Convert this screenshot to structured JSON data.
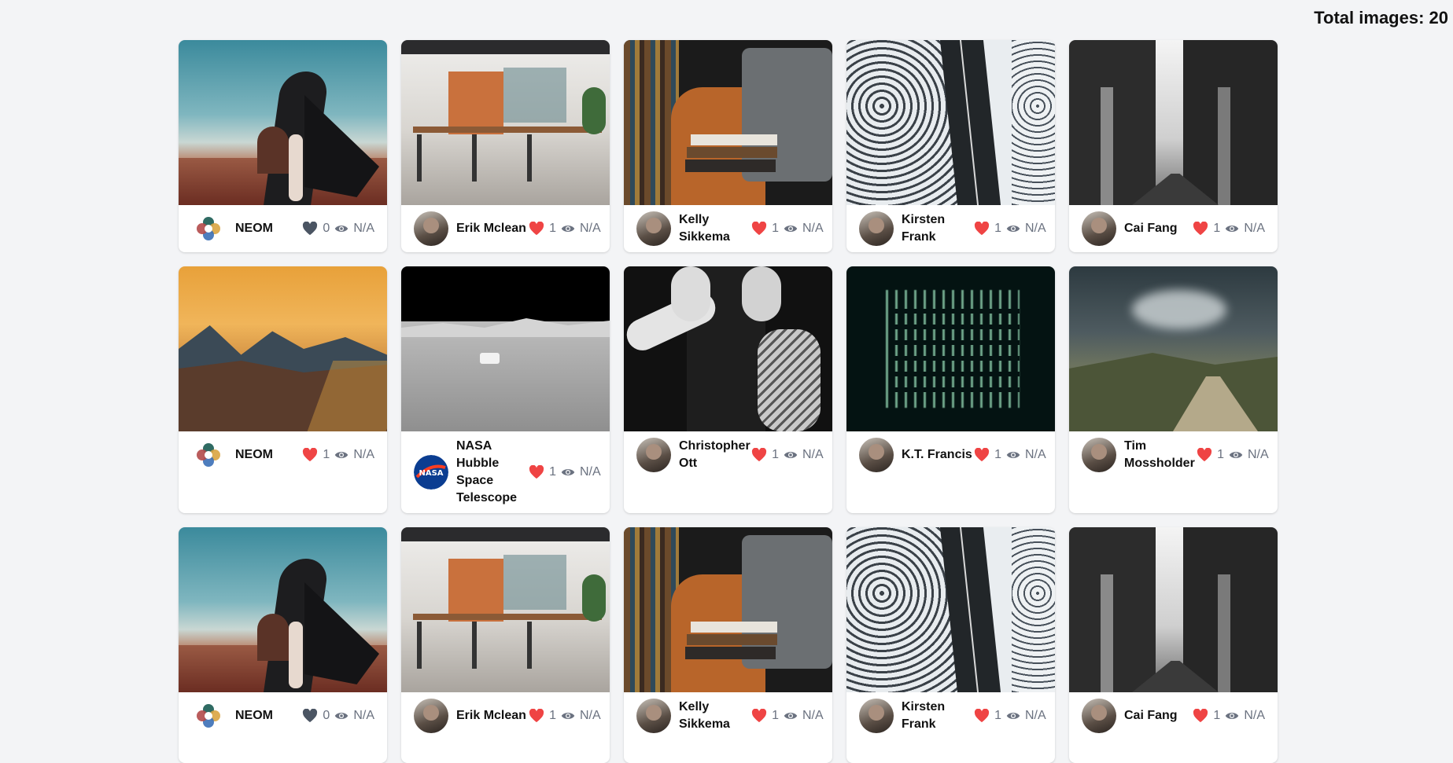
{
  "header": {
    "total_label": "Total images: 20"
  },
  "colors": {
    "liked": "#ef4444",
    "unliked": "#4b5563",
    "muted": "#6b7280"
  },
  "rows": [
    {
      "cards": [
        {
          "author": "NEOM",
          "likes": "0",
          "views": "N/A",
          "liked": false,
          "avatar": "neom-logo",
          "scene": "desert-woman"
        },
        {
          "author": "Erik Mclean",
          "likes": "1",
          "views": "N/A",
          "liked": true,
          "avatar": "photo",
          "scene": "cafe-interior"
        },
        {
          "author": "Kelly Sikkema",
          "likes": "1",
          "views": "N/A",
          "liked": true,
          "avatar": "photo",
          "scene": "books-chair"
        },
        {
          "author": "Kirsten Frank",
          "likes": "1",
          "views": "N/A",
          "liked": true,
          "avatar": "photo",
          "scene": "snowy-road"
        },
        {
          "author": "Cai Fang",
          "likes": "1",
          "views": "N/A",
          "liked": true,
          "avatar": "photo",
          "scene": "bridge-underpass"
        }
      ]
    },
    {
      "cards": [
        {
          "author": "NEOM",
          "likes": "1",
          "views": "N/A",
          "liked": true,
          "avatar": "neom-logo",
          "scene": "mountain-sunset"
        },
        {
          "author": "NASA Hubble Space Telescope",
          "likes": "1",
          "views": "N/A",
          "liked": true,
          "avatar": "nasa-logo",
          "scene": "moon-rover"
        },
        {
          "author": "Christopher Ott",
          "likes": "1",
          "views": "N/A",
          "liked": true,
          "avatar": "photo",
          "scene": "hands-face-bw"
        },
        {
          "author": "K.T. Francis",
          "likes": "1",
          "views": "N/A",
          "liked": true,
          "avatar": "photo",
          "scene": "night-building-lights"
        },
        {
          "author": "Tim Mossholder",
          "likes": "1",
          "views": "N/A",
          "liked": true,
          "avatar": "photo",
          "scene": "storm-road"
        }
      ]
    },
    {
      "cards": [
        {
          "author": "NEOM",
          "likes": "0",
          "views": "N/A",
          "liked": false,
          "avatar": "neom-logo",
          "scene": "desert-woman"
        },
        {
          "author": "Erik Mclean",
          "likes": "1",
          "views": "N/A",
          "liked": true,
          "avatar": "photo",
          "scene": "cafe-interior"
        },
        {
          "author": "Kelly Sikkema",
          "likes": "1",
          "views": "N/A",
          "liked": true,
          "avatar": "photo",
          "scene": "books-chair"
        },
        {
          "author": "Kirsten Frank",
          "likes": "1",
          "views": "N/A",
          "liked": true,
          "avatar": "photo",
          "scene": "snowy-road"
        },
        {
          "author": "Cai Fang",
          "likes": "1",
          "views": "N/A",
          "liked": true,
          "avatar": "photo",
          "scene": "bridge-underpass"
        }
      ]
    }
  ]
}
